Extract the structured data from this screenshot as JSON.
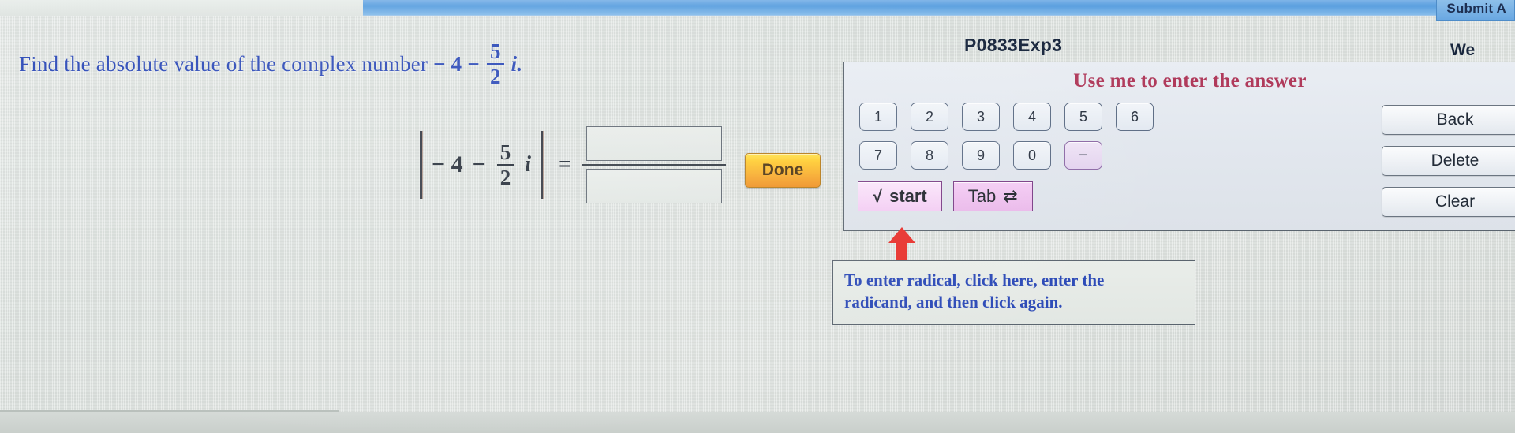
{
  "topbar": {
    "submit_label": "Submit A"
  },
  "problem": {
    "text_before": "Find the absolute value of the complex number",
    "real_part": "− 4",
    "operator": "−",
    "fraction_numerator": "5",
    "fraction_denominator": "2",
    "imaginary_unit": "i.",
    "accent_color": "#2b49b7"
  },
  "equation": {
    "left_bar": "|",
    "real_part": "− 4",
    "operator": "−",
    "fraction_numerator": "5",
    "fraction_denominator": "2",
    "imaginary_unit": "i",
    "right_bar": "|",
    "equals": "=",
    "answer_numerator_value": "",
    "answer_denominator_value": "",
    "answer_numerator_placeholder": "",
    "answer_denominator_placeholder": ""
  },
  "done_button": {
    "label": "Done",
    "color": "#f6a62a"
  },
  "keypad": {
    "title": "P0833Exp3",
    "we_label": "We",
    "header": "Use me to enter the answer",
    "digits_row1": [
      "1",
      "2",
      "3",
      "4",
      "5",
      "6"
    ],
    "digits_row2": [
      "7",
      "8",
      "9",
      "0"
    ],
    "minus_key": "−",
    "actions": [
      "Back",
      "Delete",
      "Clear"
    ],
    "radical_button": {
      "icon": "√",
      "label": "start"
    },
    "tab_button": {
      "label": "Tab",
      "icon": "⇄"
    }
  },
  "instruction": {
    "line1": "To enter radical, click here, enter the",
    "line2": "radicand, and then click again.",
    "arrow_color": "#e8302b"
  }
}
